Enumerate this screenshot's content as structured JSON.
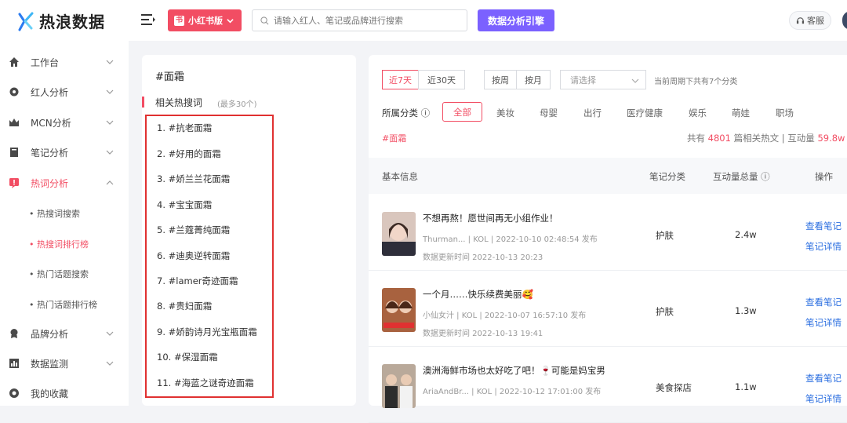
{
  "brand": {
    "name": "热浪数据",
    "accent": "#f24d63",
    "engine_color": "#7b61ff"
  },
  "topbar": {
    "platform_label": "小红书版",
    "search_placeholder": "请输入红人、笔记或品牌进行搜索",
    "engine_label": "数据分析引擎",
    "service_label": "客服"
  },
  "sidebar": {
    "items": [
      {
        "label": "工作台",
        "icon": "home-icon"
      },
      {
        "label": "红人分析",
        "icon": "gear-icon"
      },
      {
        "label": "MCN分析",
        "icon": "crown-icon"
      },
      {
        "label": "笔记分析",
        "icon": "book-icon"
      },
      {
        "label": "热词分析",
        "icon": "fire-icon"
      },
      {
        "label": "品牌分析",
        "icon": "badge-icon"
      },
      {
        "label": "数据监测",
        "icon": "chart-icon"
      },
      {
        "label": "我的收藏",
        "icon": "star-icon"
      }
    ],
    "sub_items": [
      {
        "label": "• 热搜词搜索"
      },
      {
        "label": "• 热搜词排行榜"
      },
      {
        "label": "• 热门话题搜索"
      },
      {
        "label": "• 热门话题排行榜"
      }
    ]
  },
  "left_panel": {
    "keyword": "#面霜",
    "section_title": "相关热搜词",
    "section_note": "(最多30个)",
    "hot_words": [
      "1. #抗老面霜",
      "2. #好用的面霜",
      "3. #娇兰兰花面霜",
      "4. #宝宝面霜",
      "5. #兰蔻菁纯面霜",
      "6. #迪奥逆转面霜",
      "7. #lamer奇迹面霜",
      "8. #贵妇面霜",
      "9. #娇韵诗月光宝瓶面霜",
      "10. #保湿面霜",
      "11. #海蓝之谜奇迹面霜"
    ]
  },
  "right_panel": {
    "range_tabs": [
      "近7天",
      "近30天"
    ],
    "period_tabs": [
      "按周",
      "按月"
    ],
    "select_placeholder": "请选择",
    "period_note": "当前周期下共有7个分类",
    "category_label": "所属分类 ⓘ",
    "categories": [
      "全部",
      "美妆",
      "母婴",
      "出行",
      "医疗健康",
      "娱乐",
      "萌娃",
      "职场"
    ],
    "tag": "#面霜",
    "summary": {
      "prefix": "共有",
      "count": "4801",
      "middle": "篇相关热文 | 互动量",
      "interaction": "59.8w"
    },
    "headers": {
      "info": "基本信息",
      "category": "笔记分类",
      "interaction": "互动量总量 ⓘ",
      "action": "操作"
    },
    "rows": [
      {
        "title": "不想再熬！愿世间再无小组作业！",
        "meta": "Thurman...  | KOL | 2022-10-10 02:48:54 发布",
        "updated": "数据更新时间 2022-10-13 20:23",
        "category": "护肤",
        "interaction": "2.4w",
        "action1": "查看笔记",
        "action2": "笔记详情"
      },
      {
        "title": "一个月……快乐续费美丽🥰",
        "meta": "小仙女汁 | KOL | 2022-10-07 16:57:10 发布",
        "updated": "数据更新时间 2022-10-13 19:41",
        "category": "护肤",
        "interaction": "1.3w",
        "action1": "查看笔记",
        "action2": "笔记详情"
      },
      {
        "title": "澳洲海鲜市场也太好吃了吧！🍷可能是妈宝男",
        "meta": "AriaAndBr... | KOL | 2022-10-12 17:01:00 发布",
        "updated": "",
        "category": "美食探店",
        "interaction": "1.1w",
        "action1": "查看笔记",
        "action2": "笔记详情"
      }
    ]
  }
}
